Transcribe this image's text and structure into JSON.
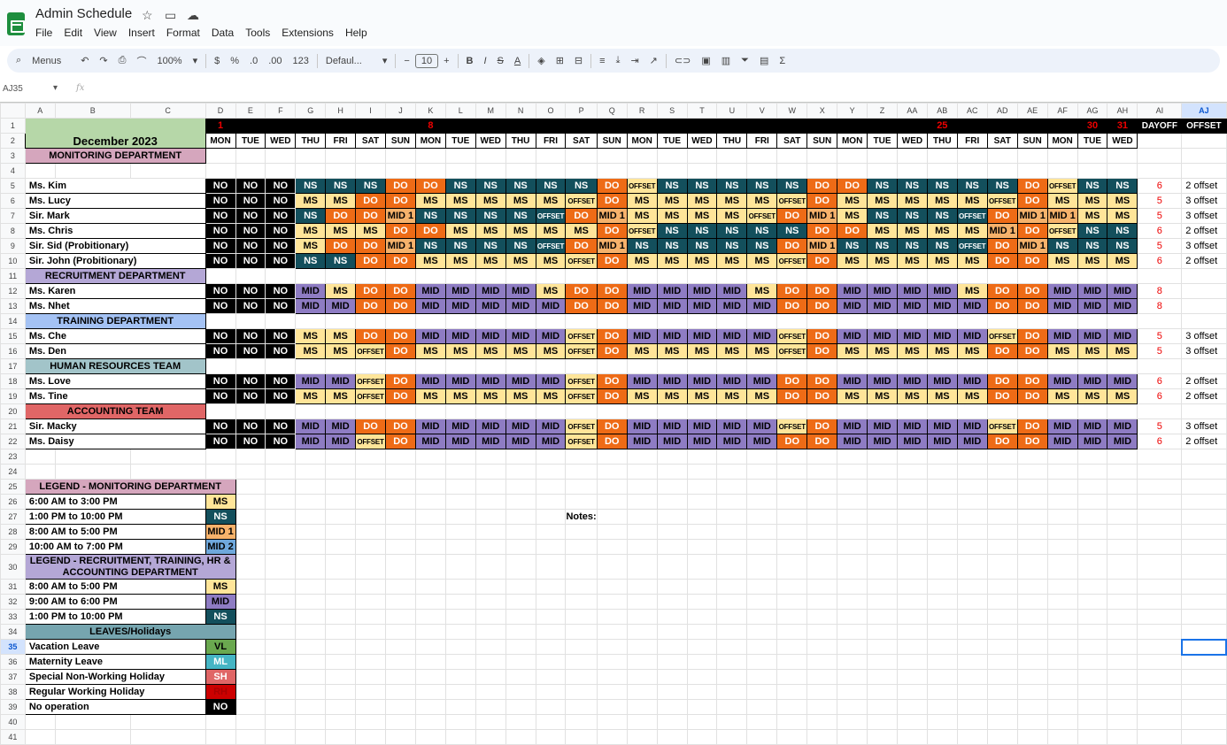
{
  "app": {
    "title": "Admin Schedule",
    "menus": [
      "File",
      "Edit",
      "View",
      "Insert",
      "Format",
      "Data",
      "Tools",
      "Extensions",
      "Help"
    ]
  },
  "toolbar": {
    "search_label": "Menus",
    "zoom": "100%",
    "currency": "$",
    "percent": "%",
    "dec_less": ".0",
    "dec_more": ".00",
    "format_num": "123",
    "font": "Defaul...",
    "font_size": "10",
    "bold": "B",
    "italic": "I",
    "strike": "S",
    "text_color": "A",
    "sigma": "Σ"
  },
  "formula_bar": {
    "name_box": "AJ35",
    "fx": "fx"
  },
  "columns": [
    "A",
    "B",
    "C",
    "D",
    "E",
    "F",
    "G",
    "H",
    "I",
    "J",
    "K",
    "L",
    "M",
    "N",
    "O",
    "P",
    "Q",
    "R",
    "S",
    "T",
    "U",
    "V",
    "W",
    "X",
    "Y",
    "Z",
    "AA",
    "AB",
    "AC",
    "AD",
    "AE",
    "AF",
    "AG",
    "AH",
    "AI",
    "AJ"
  ],
  "schedule": {
    "title": "December 2023",
    "dates": [
      "1",
      "2",
      "3",
      "4",
      "5",
      "6",
      "7",
      "8",
      "9",
      "10",
      "11",
      "12",
      "13",
      "14",
      "15",
      "16",
      "17",
      "18",
      "19",
      "20",
      "21",
      "22",
      "23",
      "24",
      "25",
      "26",
      "27",
      "28",
      "29",
      "30",
      "31"
    ],
    "red_dates": [
      "1",
      "8",
      "25",
      "30",
      "31"
    ],
    "weekdays": [
      "MON",
      "TUE",
      "WED",
      "THU",
      "FRI",
      "SAT",
      "SUN",
      "MON",
      "TUE",
      "WED",
      "THU",
      "FRI",
      "SAT",
      "SUN",
      "MON",
      "TUE",
      "WED",
      "THU",
      "FRI",
      "SAT",
      "SUN",
      "MON",
      "TUE",
      "WED",
      "THU",
      "FRI",
      "SAT",
      "SUN",
      "MON",
      "TUE",
      "WED"
    ],
    "dayoff_header": "DAYOFF",
    "offset_header": "OFFSET",
    "notes_label": "Notes:",
    "rows": [
      {
        "r": 3,
        "dept": "MONITORING DEPARTMENT",
        "color": "#d5a6bd"
      },
      {
        "r": 4,
        "blank": true
      },
      {
        "r": 5,
        "name": "Ms. Kim",
        "shifts": [
          "NO",
          "NO",
          "NO",
          "NS",
          "NS",
          "NS",
          "DO",
          "DO",
          "NS",
          "NS",
          "NS",
          "NS",
          "NS",
          "DO",
          "OFFSET",
          "NS",
          "NS",
          "NS",
          "NS",
          "NS",
          "DO",
          "DO",
          "NS",
          "NS",
          "NS",
          "NS",
          "NS",
          "DO",
          "OFFSET",
          "NS",
          "NS"
        ],
        "dayoff": "6",
        "offset": "2 offset"
      },
      {
        "r": 6,
        "name": "Ms. Lucy",
        "shifts": [
          "NO",
          "NO",
          "NO",
          "MS",
          "MS",
          "DO",
          "DO",
          "MS",
          "MS",
          "MS",
          "MS",
          "MS",
          "OFFSET",
          "DO",
          "MS",
          "MS",
          "MS",
          "MS",
          "MS",
          "OFFSET",
          "DO",
          "MS",
          "MS",
          "MS",
          "MS",
          "MS",
          "OFFSET",
          "DO",
          "MS",
          "MS",
          "MS"
        ],
        "dayoff": "5",
        "offset": "3 offset"
      },
      {
        "r": 7,
        "name": "Sir. Mark",
        "shifts": [
          "NO",
          "NO",
          "NO",
          "NS",
          "DO",
          "DO",
          "MID 1",
          "NS",
          "NS",
          "NS",
          "NS",
          "OFFSET",
          "DO",
          "MID 1",
          "MS",
          "MS",
          "MS",
          "MS",
          "OFFSET",
          "DO",
          "MID 1",
          "MS",
          "NS",
          "NS",
          "NS",
          "OFFSET",
          "DO",
          "MID 1",
          "MID 1",
          "MS",
          "MS"
        ],
        "dayoff": "5",
        "offset": "3 offset"
      },
      {
        "r": 8,
        "name": "Ms. Chris",
        "shifts": [
          "NO",
          "NO",
          "NO",
          "MS",
          "MS",
          "MS",
          "DO",
          "DO",
          "MS",
          "MS",
          "MS",
          "MS",
          "MS",
          "DO",
          "OFFSET",
          "NS",
          "NS",
          "NS",
          "NS",
          "NS",
          "DO",
          "DO",
          "MS",
          "MS",
          "MS",
          "MS",
          "MID 1",
          "DO",
          "OFFSET",
          "NS",
          "NS"
        ],
        "dayoff": "6",
        "offset": "2 offset"
      },
      {
        "r": 9,
        "name": "Sir. Sid (Probitionary)",
        "shifts": [
          "NO",
          "NO",
          "NO",
          "MS",
          "DO",
          "DO",
          "MID 1",
          "NS",
          "NS",
          "NS",
          "NS",
          "OFFSET",
          "DO",
          "MID 1",
          "NS",
          "NS",
          "NS",
          "NS",
          "NS",
          "DO",
          "MID 1",
          "NS",
          "NS",
          "NS",
          "NS",
          "OFFSET",
          "DO",
          "MID 1",
          "NS",
          "NS",
          "NS"
        ],
        "dayoff": "5",
        "offset": "3 offset"
      },
      {
        "r": 10,
        "name": "Sir. John (Probitionary)",
        "shifts": [
          "NO",
          "NO",
          "NO",
          "NS",
          "NS",
          "DO",
          "DO",
          "MS",
          "MS",
          "MS",
          "MS",
          "MS",
          "OFFSET",
          "DO",
          "MS",
          "MS",
          "MS",
          "MS",
          "MS",
          "OFFSET",
          "DO",
          "MS",
          "MS",
          "MS",
          "MS",
          "MS",
          "DO",
          "DO",
          "MS",
          "MS",
          "MS"
        ],
        "dayoff": "6",
        "offset": "2 offset"
      },
      {
        "r": 11,
        "dept": "RECRUITMENT DEPARTMENT",
        "color": "#b4a7d6"
      },
      {
        "r": 12,
        "name": "Ms. Karen",
        "shifts": [
          "NO",
          "NO",
          "NO",
          "MID",
          "MS",
          "DO",
          "DO",
          "MID",
          "MID",
          "MID",
          "MID",
          "MS",
          "DO",
          "DO",
          "MID",
          "MID",
          "MID",
          "MID",
          "MS",
          "DO",
          "DO",
          "MID",
          "MID",
          "MID",
          "MID",
          "MS",
          "DO",
          "DO",
          "MID",
          "MID",
          "MID"
        ],
        "dayoff": "8",
        "offset": ""
      },
      {
        "r": 13,
        "name": "Ms. Nhet",
        "shifts": [
          "NO",
          "NO",
          "NO",
          "MID",
          "MID",
          "DO",
          "DO",
          "MID",
          "MID",
          "MID",
          "MID",
          "MID",
          "DO",
          "DO",
          "MID",
          "MID",
          "MID",
          "MID",
          "MID",
          "DO",
          "DO",
          "MID",
          "MID",
          "MID",
          "MID",
          "MID",
          "DO",
          "DO",
          "MID",
          "MID",
          "MID"
        ],
        "dayoff": "8",
        "offset": ""
      },
      {
        "r": 14,
        "dept": "TRAINING DEPARTMENT",
        "color": "#a4c2f4"
      },
      {
        "r": 15,
        "name": "Ms. Che",
        "shifts": [
          "NO",
          "NO",
          "NO",
          "MS",
          "MS",
          "DO",
          "DO",
          "MID",
          "MID",
          "MID",
          "MID",
          "MID",
          "OFFSET",
          "DO",
          "MID",
          "MID",
          "MID",
          "MID",
          "MID",
          "OFFSET",
          "DO",
          "MID",
          "MID",
          "MID",
          "MID",
          "MID",
          "OFFSET",
          "DO",
          "MID",
          "MID",
          "MID"
        ],
        "dayoff": "5",
        "offset": "3 offset"
      },
      {
        "r": 16,
        "name": "Ms. Den",
        "shifts": [
          "NO",
          "NO",
          "NO",
          "MS",
          "MS",
          "OFFSET",
          "DO",
          "MS",
          "MS",
          "MS",
          "MS",
          "MS",
          "OFFSET",
          "DO",
          "MS",
          "MS",
          "MS",
          "MS",
          "MS",
          "OFFSET",
          "DO",
          "MS",
          "MS",
          "MS",
          "MS",
          "MS",
          "DO",
          "DO",
          "MS",
          "MS",
          "MS"
        ],
        "dayoff": "5",
        "offset": "3 offset"
      },
      {
        "r": 17,
        "dept": "HUMAN RESOURCES TEAM",
        "color": "#a2c4c9"
      },
      {
        "r": 18,
        "name": "Ms. Love",
        "shifts": [
          "NO",
          "NO",
          "NO",
          "MID",
          "MID",
          "OFFSET",
          "DO",
          "MID",
          "MID",
          "MID",
          "MID",
          "MID",
          "OFFSET",
          "DO",
          "MID",
          "MID",
          "MID",
          "MID",
          "MID",
          "DO",
          "DO",
          "MID",
          "MID",
          "MID",
          "MID",
          "MID",
          "DO",
          "DO",
          "MID",
          "MID",
          "MID"
        ],
        "dayoff": "6",
        "offset": "2 offset"
      },
      {
        "r": 19,
        "name": "Ms. Tine",
        "shifts": [
          "NO",
          "NO",
          "NO",
          "MS",
          "MS",
          "OFFSET",
          "DO",
          "MS",
          "MS",
          "MS",
          "MS",
          "MS",
          "OFFSET",
          "DO",
          "MS",
          "MS",
          "MS",
          "MS",
          "MS",
          "DO",
          "DO",
          "MS",
          "MS",
          "MS",
          "MS",
          "MS",
          "DO",
          "DO",
          "MS",
          "MS",
          "MS"
        ],
        "dayoff": "6",
        "offset": "2 offset"
      },
      {
        "r": 20,
        "dept": "ACCOUNTING TEAM",
        "color": "#e06666"
      },
      {
        "r": 21,
        "name": "Sir. Macky",
        "shifts": [
          "NO",
          "NO",
          "NO",
          "MID",
          "MID",
          "DO",
          "DO",
          "MID",
          "MID",
          "MID",
          "MID",
          "MID",
          "OFFSET",
          "DO",
          "MID",
          "MID",
          "MID",
          "MID",
          "MID",
          "OFFSET",
          "DO",
          "MID",
          "MID",
          "MID",
          "MID",
          "MID",
          "OFFSET",
          "DO",
          "MID",
          "MID",
          "MID"
        ],
        "dayoff": "5",
        "offset": "3 offset"
      },
      {
        "r": 22,
        "name": "Ms. Daisy",
        "shifts": [
          "NO",
          "NO",
          "NO",
          "MID",
          "MID",
          "OFFSET",
          "DO",
          "MID",
          "MID",
          "MID",
          "MID",
          "MID",
          "OFFSET",
          "DO",
          "MID",
          "MID",
          "MID",
          "MID",
          "MID",
          "DO",
          "DO",
          "MID",
          "MID",
          "MID",
          "MID",
          "MID",
          "DO",
          "DO",
          "MID",
          "MID",
          "MID"
        ],
        "dayoff": "6",
        "offset": "2 offset"
      }
    ]
  },
  "legends": [
    {
      "r": 25,
      "header": "LEGEND - MONITORING DEPARTMENT",
      "color": "#d5a6bd"
    },
    {
      "r": 26,
      "label": "6:00 AM to 3:00 PM",
      "code": "MS",
      "cls": "s-MS"
    },
    {
      "r": 27,
      "label": "1:00 PM to 10:00 PM",
      "code": "NS",
      "cls": "s-NS"
    },
    {
      "r": 28,
      "label": "8:00 AM to 5:00 PM",
      "code": "MID 1",
      "cls": "s-MID1"
    },
    {
      "r": 29,
      "label": "10:00 AM to 7:00 PM",
      "code": "MID 2",
      "cls": "s-MID2"
    },
    {
      "r": 30,
      "header": "LEGEND - RECRUITMENT, TRAINING, HR & ACCOUNTING DEPARTMENT",
      "color": "#b4a7d6",
      "tall": true
    },
    {
      "r": 31,
      "label": "8:00 AM to 5:00 PM",
      "code": "MS",
      "cls": "s-MS"
    },
    {
      "r": 32,
      "label": "9:00 AM to 6:00 PM",
      "code": "MID",
      "cls": "s-MID"
    },
    {
      "r": 33,
      "label": "1:00 PM to 10:00 PM",
      "code": "NS",
      "cls": "s-NS"
    },
    {
      "r": 34,
      "header": "LEAVES/Holidays",
      "color": "#76a5af"
    },
    {
      "r": 35,
      "label": "Vacation Leave",
      "code": "VL",
      "bg": "#6aa84f",
      "fg": "#000"
    },
    {
      "r": 36,
      "label": "Maternity Leave",
      "code": "ML",
      "bg": "#45b5c4",
      "fg": "#fff"
    },
    {
      "r": 37,
      "label": "Special Non-Working Holiday",
      "code": "SH",
      "bg": "#e06666",
      "fg": "#fff"
    },
    {
      "r": 38,
      "label": "Regular Working Holiday",
      "code": "RH",
      "bg": "#cc0000",
      "fg": "#a00"
    },
    {
      "r": 39,
      "label": "No operation",
      "code": "NO",
      "bg": "#000",
      "fg": "#fff"
    }
  ],
  "max_row": 41
}
